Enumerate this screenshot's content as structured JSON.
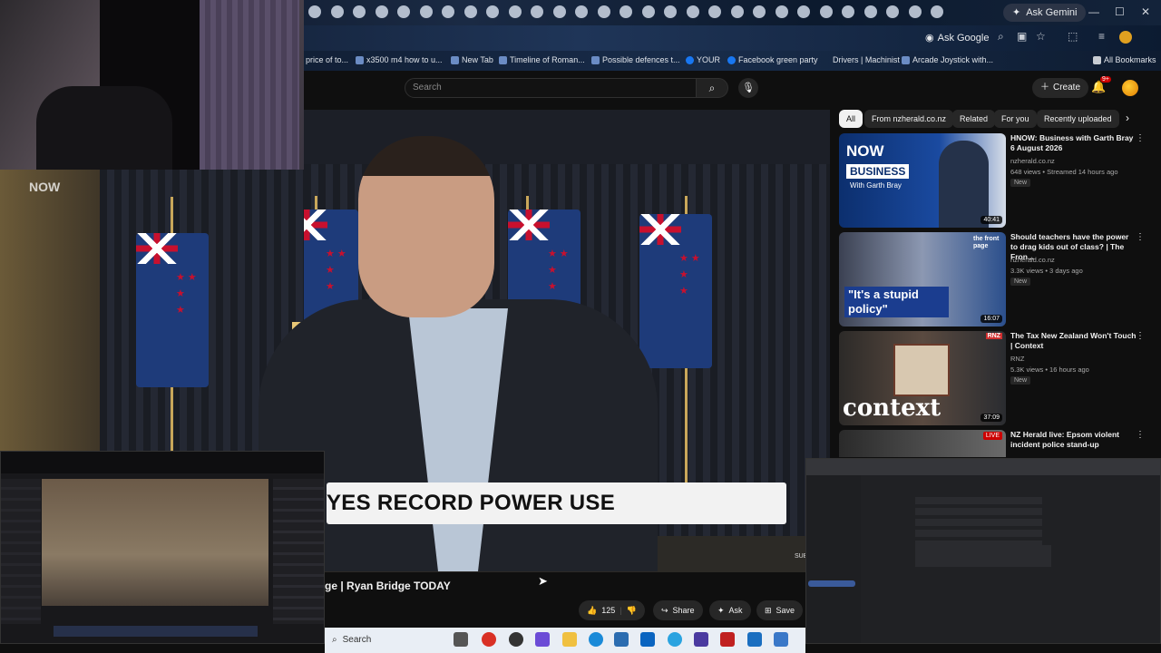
{
  "browser": {
    "ask_gemini": "Ask Gemini",
    "ask_google": "Ask Google",
    "bookmarks": [
      "price of to...",
      "x3500 m4 how to u...",
      "New Tab",
      "Timeline of Roman...",
      "Possible defences t...",
      "YOUR",
      "Facebook green party",
      "Drivers | Machinist",
      "Arcade Joystick with..."
    ],
    "all_bookmarks": "All Bookmarks"
  },
  "youtube": {
    "search_placeholder": "Search",
    "create_label": "Create",
    "notifications": "9+",
    "video": {
      "lower_third": "YES RECORD POWER USE",
      "now_logo": "NOW",
      "sub_label": "SUB",
      "title": "ge | Ryan Bridge TODAY"
    },
    "actions": {
      "likes": "125",
      "share": "Share",
      "ask": "Ask",
      "save": "Save"
    },
    "chips": [
      "All",
      "From nzherald.co.nz",
      "Related",
      "For you",
      "Recently uploaded"
    ],
    "recommendations": [
      {
        "title": "HNOW: Business with Garth Bray 6 August 2026",
        "channel": "nzherald.co.nz",
        "meta": "648 views • Streamed 14 hours ago",
        "badge": "New",
        "duration": "40:41",
        "thumb_text_1": "NOW",
        "thumb_text_2": "BUSINESS",
        "thumb_text_3": "With Garth Bray"
      },
      {
        "title": "Should teachers have the power to drag kids out of class? | The Fron...",
        "channel": "nzherald.co.nz",
        "meta": "3.3K views • 3 days ago",
        "badge": "New",
        "duration": "16:07",
        "thumb_text_1": "\"It's a stupid policy\"",
        "thumb_text_2": "the front page"
      },
      {
        "title": "The Tax New Zealand Won't Touch | Context",
        "channel": "RNZ",
        "meta": "5.3K views • 16 hours ago",
        "badge": "New",
        "duration": "37:09",
        "thumb_text_1": "context",
        "thumb_text_2": "RNZ"
      },
      {
        "title": "NZ Herald live: Epsom violent incident police stand-up",
        "channel": "",
        "meta": "",
        "badge": "",
        "duration": "",
        "live": "LIVE"
      }
    ]
  },
  "taskbar": {
    "search": "Search"
  },
  "colors": {
    "yt_bg": "#0f0f0f",
    "chip_bg": "#272727",
    "live_red": "#cc0000",
    "flag_blue": "#1e3b7a",
    "flag_red": "#c8102e"
  }
}
